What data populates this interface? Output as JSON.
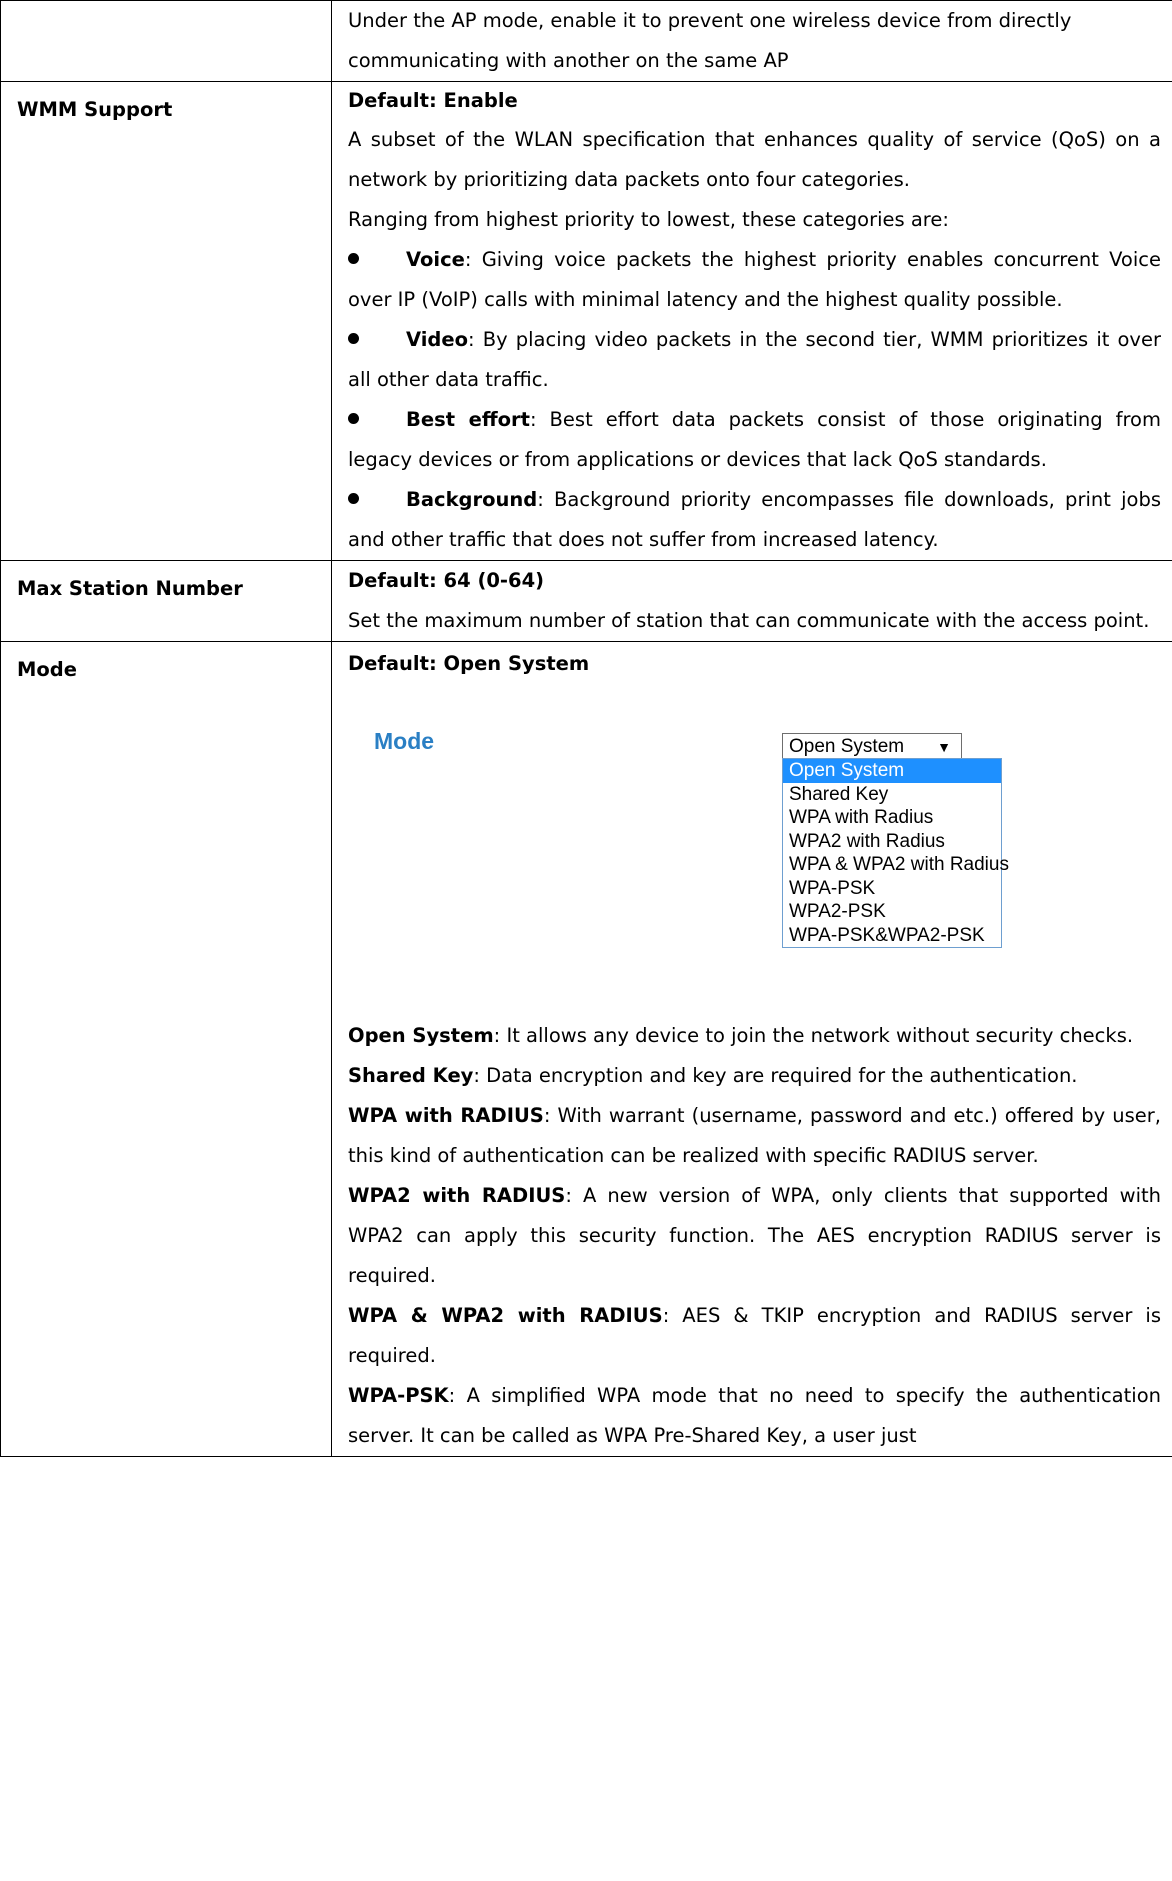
{
  "row0": {
    "label": "",
    "lines": [
      "Under the AP mode, enable it to prevent one wireless device from directly",
      "communicating with another on the same AP"
    ]
  },
  "wmm": {
    "label": "WMM Support",
    "default": "Default: Enable",
    "intro1": "A subset of the WLAN specification that enhances quality of service (QoS) on a network by prioritizing data packets onto four categories.",
    "intro2": "Ranging from highest priority to lowest, these categories are:",
    "bullets": [
      {
        "term": "Voice",
        "text": ": Giving voice packets the highest priority enables concurrent Voice over IP (VoIP) calls with minimal latency and the highest quality possible."
      },
      {
        "term": "Video",
        "text": ": By placing video packets in the second tier, WMM prioritizes it over all other data traffic."
      },
      {
        "term": "Best effort",
        "text": ": Best effort data packets consist of those originating from legacy devices or from applications or devices that lack QoS standards."
      },
      {
        "term": "Background",
        "text": ": Background priority encompasses file downloads, print jobs and other traffic that does not suffer from increased latency."
      }
    ]
  },
  "maxsta": {
    "label": "Max Station Number",
    "default": "Default: 64 (0-64)",
    "text": "Set the maximum number of station that can communicate with the access point."
  },
  "mode": {
    "label": "Mode",
    "default": "Default: Open System",
    "screenshot_label": "Mode",
    "select_value": "Open System",
    "options": [
      "Open System",
      "Shared Key",
      "WPA with Radius",
      "WPA2 with Radius",
      "WPA & WPA2 with Radius",
      "WPA-PSK",
      "WPA2-PSK",
      "WPA-PSK&WPA2-PSK"
    ],
    "items": [
      {
        "term": "Open System",
        "text": ": It allows any device to join the network without security checks."
      },
      {
        "term": "Shared Key",
        "text": ": Data encryption and key are required for the authentication."
      },
      {
        "term": "WPA with RADIUS",
        "text": ": With warrant (username, password and etc.) offered by user, this kind of authentication can be realized with specific RADIUS server."
      },
      {
        "term": "WPA2 with RADIUS",
        "text": ": A new version of WPA, only clients that supported with WPA2 can apply this security function. The AES encryption RADIUS server is required."
      },
      {
        "term": "WPA & WPA2 with RADIUS",
        "text": ": AES & TKIP encryption and RADIUS server is required."
      },
      {
        "term": "WPA-PSK",
        "text": ": A simplified WPA mode that no need to specify the authentication server. It can be called as WPA Pre-Shared Key, a user just"
      }
    ]
  },
  "colors": {
    "screenshot_label": "#2a7fc4",
    "selected_option": "#1e90ff"
  }
}
